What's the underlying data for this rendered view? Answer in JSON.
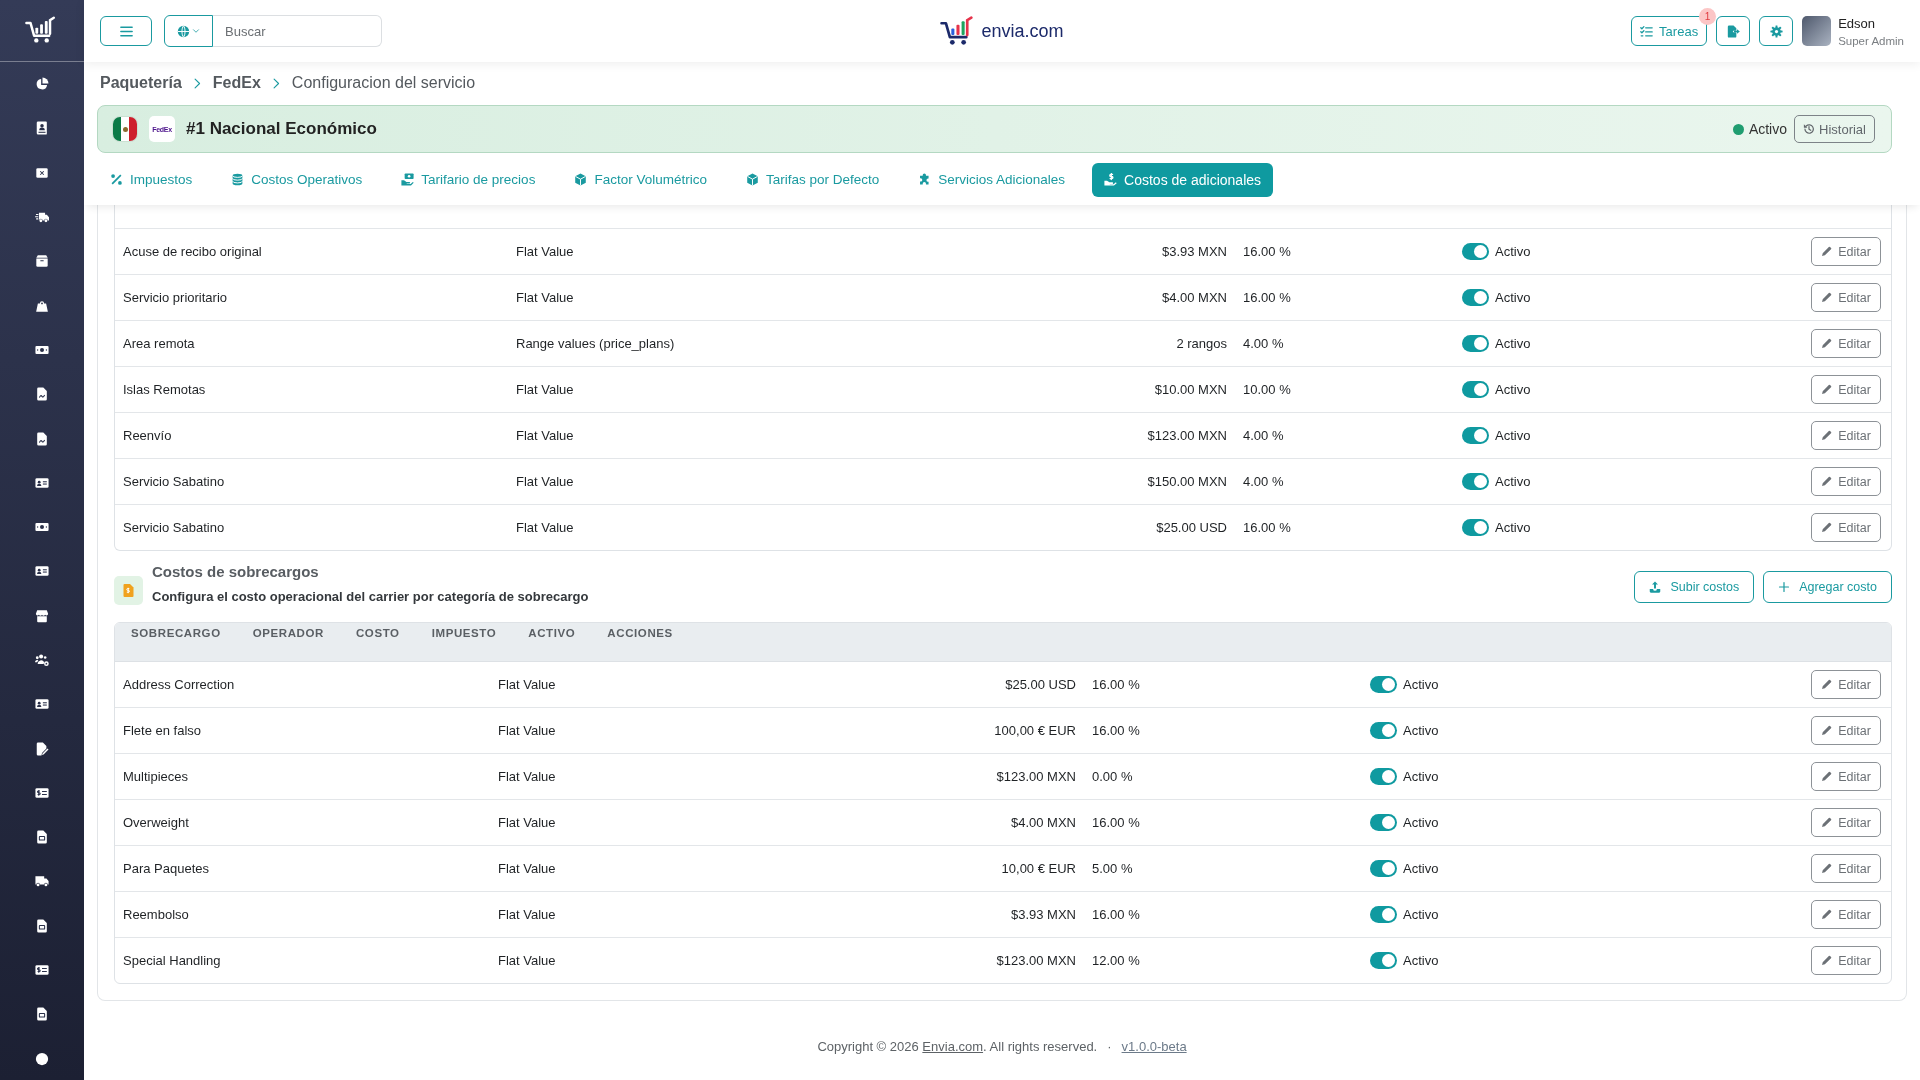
{
  "topbar": {
    "search": {
      "placeholder": "Buscar"
    },
    "logo_text": "envia.com",
    "tasks": {
      "label": "Tareas",
      "badge": "1"
    },
    "user": {
      "name": "Edson",
      "role": "Super Admin"
    }
  },
  "breadcrumb": [
    "Paquetería",
    "FedEx",
    "Configuracion del servicio"
  ],
  "service": {
    "carrier_logo": "FedEx",
    "title": "#1 Nacional Económico",
    "status": {
      "label": "Activo",
      "on": true
    },
    "history_button": "Historial"
  },
  "tabs": [
    {
      "label": "Impuestos",
      "selected": false
    },
    {
      "label": "Costos Operativos",
      "selected": false
    },
    {
      "label": "Tarifario de precios",
      "selected": false
    },
    {
      "label": "Factor Volumétrico",
      "selected": false
    },
    {
      "label": "Tarifas por Defecto",
      "selected": false
    },
    {
      "label": "Servicios Adicionales",
      "selected": false
    },
    {
      "label": "Costos de adicionales",
      "selected": true
    }
  ],
  "additional_costs": {
    "rows": [
      {
        "cells": [
          "Acuse de recibo original",
          "Flat Value",
          "$3.93 MXN",
          "16.00 %"
        ],
        "active": true,
        "status": "Activo",
        "action": "Editar"
      },
      {
        "cells": [
          "Servicio prioritario",
          "Flat Value",
          "$4.00 MXN",
          "16.00 %"
        ],
        "active": true,
        "status": "Activo",
        "action": "Editar"
      },
      {
        "cells": [
          "Area remota",
          "Range values (price_plans)",
          "2 rangos",
          "4.00 %"
        ],
        "active": true,
        "status": "Activo",
        "action": "Editar"
      },
      {
        "cells": [
          "Islas Remotas",
          "Flat Value",
          "$10.00 MXN",
          "10.00 %"
        ],
        "active": true,
        "status": "Activo",
        "action": "Editar"
      },
      {
        "cells": [
          "Reenvío",
          "Flat Value",
          "$123.00 MXN",
          "4.00 %"
        ],
        "active": true,
        "status": "Activo",
        "action": "Editar"
      },
      {
        "cells": [
          "Servicio Sabatino",
          "Flat Value",
          "$150.00 MXN",
          "4.00 %"
        ],
        "active": true,
        "status": "Activo",
        "action": "Editar"
      },
      {
        "cells": [
          "Servicio Sabatino",
          "Flat Value",
          "$25.00 USD",
          "16.00 %"
        ],
        "active": true,
        "status": "Activo",
        "action": "Editar"
      }
    ]
  },
  "surcharges": {
    "title": "Costos de sobrecargos",
    "subtitle": "Configura el costo operacional del carrier por categoría de sobrecargo",
    "buttons": [
      {
        "label": "Subir costos",
        "kind": "upload"
      },
      {
        "label": "Agregar costo",
        "kind": "add"
      }
    ],
    "table": {
      "columns": [
        "SOBRECARGO",
        "OPERADOR",
        "COSTO",
        "IMPUESTO",
        "ACTIVO",
        "ACCIONES"
      ],
      "rows": [
        {
          "cells": [
            "Address Correction",
            "Flat Value",
            "$25.00 USD",
            "16.00 %"
          ],
          "active": true,
          "status": "Activo",
          "action": "Editar"
        },
        {
          "cells": [
            "Flete en falso",
            "Flat Value",
            "100,00 € EUR",
            "16.00 %"
          ],
          "active": true,
          "status": "Activo",
          "action": "Editar"
        },
        {
          "cells": [
            "Multipieces",
            "Flat Value",
            "$123.00 MXN",
            "0.00 %"
          ],
          "active": true,
          "status": "Activo",
          "action": "Editar"
        },
        {
          "cells": [
            "Overweight",
            "Flat Value",
            "$4.00 MXN",
            "16.00 %"
          ],
          "active": true,
          "status": "Activo",
          "action": "Editar"
        },
        {
          "cells": [
            "Para Paquetes",
            "Flat Value",
            "10,00 € EUR",
            "5.00 %"
          ],
          "active": true,
          "status": "Activo",
          "action": "Editar"
        },
        {
          "cells": [
            "Reembolso",
            "Flat Value",
            "$3.93 MXN",
            "16.00 %"
          ],
          "active": true,
          "status": "Activo",
          "action": "Editar"
        },
        {
          "cells": [
            "Special Handling",
            "Flat Value",
            "$123.00 MXN",
            "12.00 %"
          ],
          "active": true,
          "status": "Activo",
          "action": "Editar"
        }
      ]
    }
  },
  "footer": {
    "before": "Copyright © 2026",
    "link": "Envia.com",
    "after": ". All rights reserved.",
    "separator": "·",
    "version": "v1.0.0-beta"
  }
}
